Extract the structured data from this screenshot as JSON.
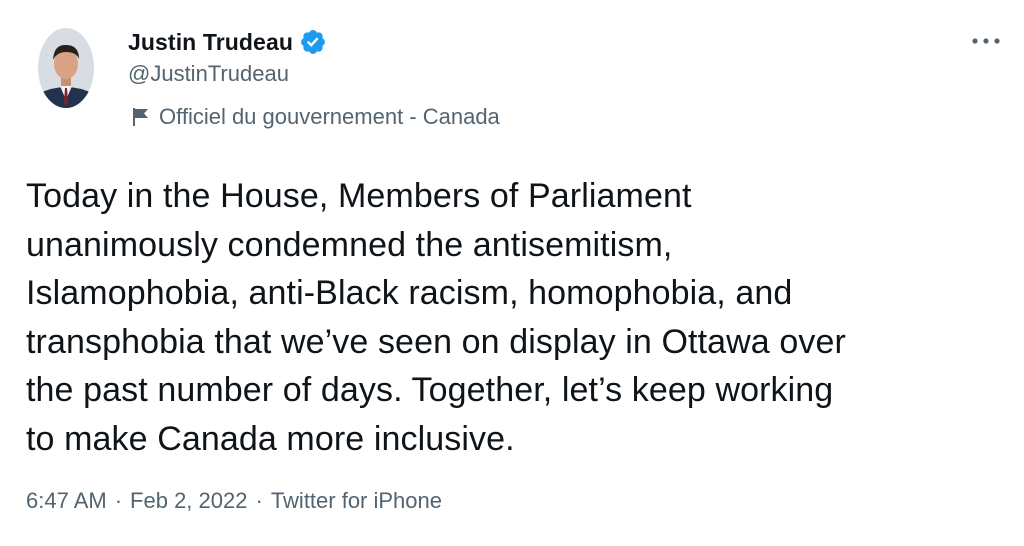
{
  "author": {
    "display_name": "Justin Trudeau",
    "handle": "@JustinTrudeau",
    "verified": true,
    "label": "Officiel du gouvernement - Canada"
  },
  "icons": {
    "verified": "verified-badge-icon",
    "label": "flag-icon",
    "more": "more-options-icon"
  },
  "tweet": {
    "text": "Today in the House, Members of Parliament\nunanimously condemned the antisemitism,\nIslamophobia, anti-Black racism, homophobia, and\ntransphobia that we’ve seen on display in Ottawa over\nthe past number of days. Together, let’s keep working\nto make Canada more inclusive.",
    "time": "6:47 AM",
    "date": "Feb 2, 2022",
    "source": "Twitter for iPhone",
    "separator": "·"
  },
  "colors": {
    "text_primary": "#0f1419",
    "text_secondary": "#536471",
    "verified_blue": "#1d9bf0"
  }
}
